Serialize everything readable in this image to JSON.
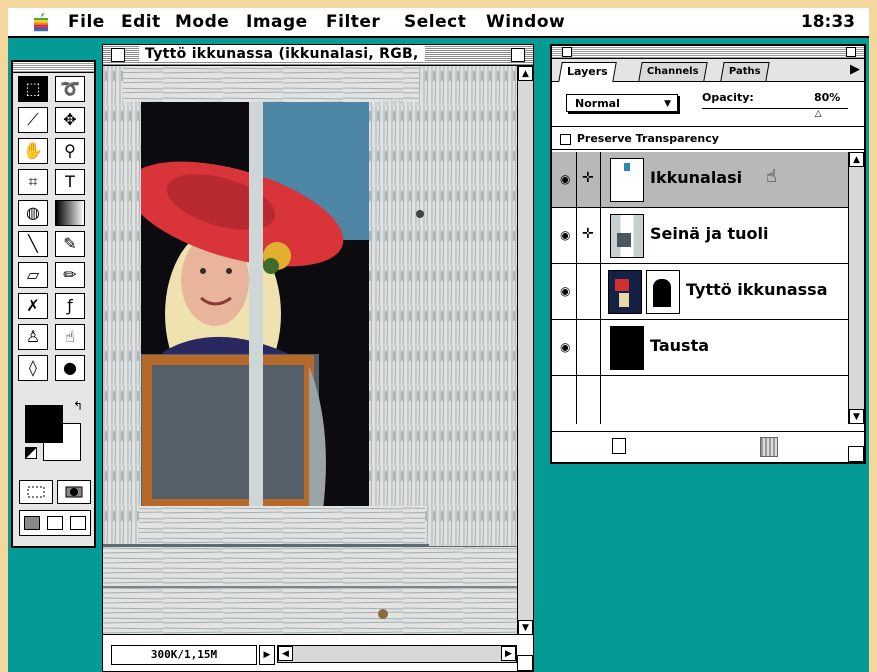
{
  "menubar": {
    "items": [
      "File",
      "Edit",
      "Mode",
      "Image",
      "Filter",
      "Select",
      "Window"
    ],
    "clock": "18:33"
  },
  "document": {
    "title": "Tyttö ikkunassa (ikkunalasi, RGB,",
    "size": "300K/1,15M"
  },
  "layers_palette": {
    "tabs": [
      "Layers",
      "Channels",
      "Paths"
    ],
    "active_tab": "Layers",
    "blend_mode": "Normal",
    "opacity_label": "Opacity:",
    "opacity_value": "80%",
    "opacity": 0.8,
    "preserve_transparency": "Preserve Transparency",
    "layers": [
      {
        "name": "Ikkunalasi",
        "selected": true
      },
      {
        "name": "Seinä ja tuoli",
        "selected": false
      },
      {
        "name": "Tyttö ikkunassa",
        "selected": false
      },
      {
        "name": "Tausta",
        "selected": false
      }
    ]
  },
  "colors": {
    "desktop": "#059a96",
    "foreground": "#000000",
    "background": "#ffffff",
    "frame": "#f3d79c"
  }
}
